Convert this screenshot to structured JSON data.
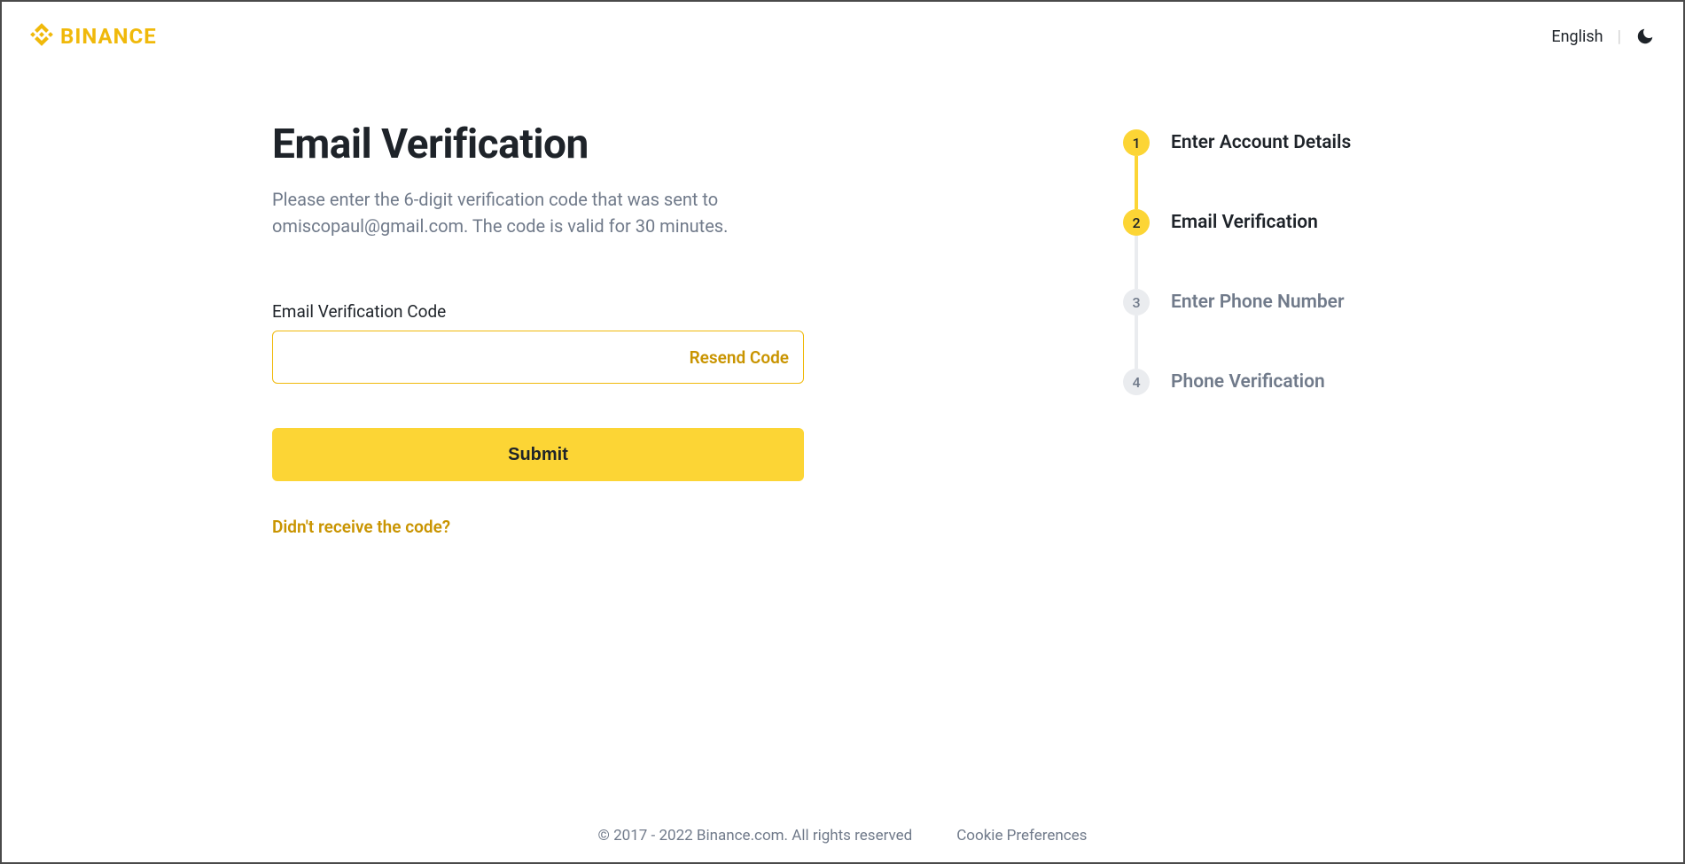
{
  "header": {
    "logo_text": "BINANCE",
    "language": "English"
  },
  "main": {
    "title": "Email Verification",
    "subtitle": "Please enter the 6-digit verification code that was sent to omiscopaul@gmail.com. The code is valid for 30 minutes.",
    "input_label": "Email Verification Code",
    "input_value": "",
    "resend_label": "Resend Code",
    "submit_label": "Submit",
    "help_link": "Didn't receive the code?"
  },
  "steps": [
    {
      "num": "1",
      "label": "Enter Account Details",
      "state": "done"
    },
    {
      "num": "2",
      "label": "Email Verification",
      "state": "done"
    },
    {
      "num": "3",
      "label": "Enter Phone Number",
      "state": "pending"
    },
    {
      "num": "4",
      "label": "Phone Verification",
      "state": "pending"
    }
  ],
  "footer": {
    "copyright": "© 2017 - 2022 Binance.com. All rights reserved",
    "cookie": "Cookie Preferences"
  },
  "colors": {
    "accent": "#FCD535",
    "accent_dark": "#F0B90B",
    "link": "#C99400",
    "muted": "#707a8a"
  }
}
